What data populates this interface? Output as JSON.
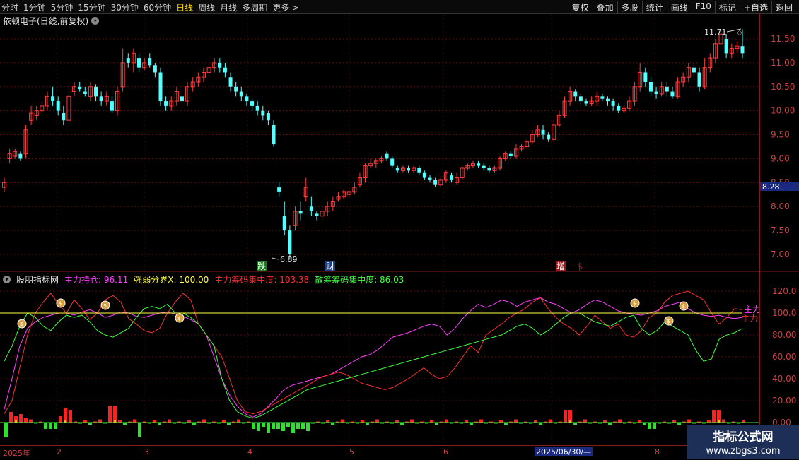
{
  "toolbar": {
    "periods": [
      "分时",
      "1分钟",
      "5分钟",
      "15分钟",
      "30分钟",
      "60分钟",
      "日线",
      "周线",
      "月线",
      "多周期",
      "更多 >"
    ],
    "active_period": "日线",
    "right_buttons": [
      "复权",
      "叠加",
      "多股",
      "统计",
      "画线",
      "F10",
      "标记",
      "+自选",
      "返回"
    ]
  },
  "main_chart": {
    "title": "依顿电子(日线,前复权)",
    "y_ticks": [
      "11.50",
      "11.00",
      "10.50",
      "10.00",
      "9.50",
      "9.00",
      "8.50",
      "8.00",
      "7.50",
      "7.00"
    ],
    "current_price_tag": "8.28",
    "high_label": "11.71",
    "low_label": "6.89",
    "markers": [
      {
        "text": "跌",
        "color": "#ffffff",
        "bg": "#1b7a1b"
      },
      {
        "text": "财",
        "color": "#ffffff",
        "bg": "#1a3f8a"
      },
      {
        "text": "增",
        "color": "#ffffff",
        "bg": "#9a1a1a"
      },
      {
        "text": "$",
        "color": "#ff3030",
        "bg": "transparent"
      }
    ]
  },
  "indicator": {
    "name": "股朋指标网",
    "fields": [
      {
        "label": "主力持仓: ",
        "value": "96.11",
        "color": "#ff40ff"
      },
      {
        "label": "强弱分界X: ",
        "value": "100.00",
        "color": "#ffff40"
      },
      {
        "label": "主力筹码集中度: ",
        "value": "103.38",
        "color": "#ff3030"
      },
      {
        "label": "散筹筹码集中度: ",
        "value": "86.03",
        "color": "#40ff40"
      }
    ],
    "y_ticks": [
      "120.0",
      "100.0",
      "80.00",
      "60.00",
      "40.00",
      "20.00",
      "0.00"
    ],
    "right_labels": [
      "主力",
      "主力"
    ]
  },
  "x_axis": {
    "labels": [
      "2025年",
      "2",
      "3",
      "4",
      "5",
      "6",
      "2025/06/30/—",
      "8"
    ]
  },
  "watermark": {
    "line1": "指标公式网",
    "line2": "www.zbgs3.com"
  },
  "colors": {
    "up": "#ff3c3c",
    "down": "#54ffff",
    "grid": "#5a1010",
    "axis": "#d04040"
  }
}
